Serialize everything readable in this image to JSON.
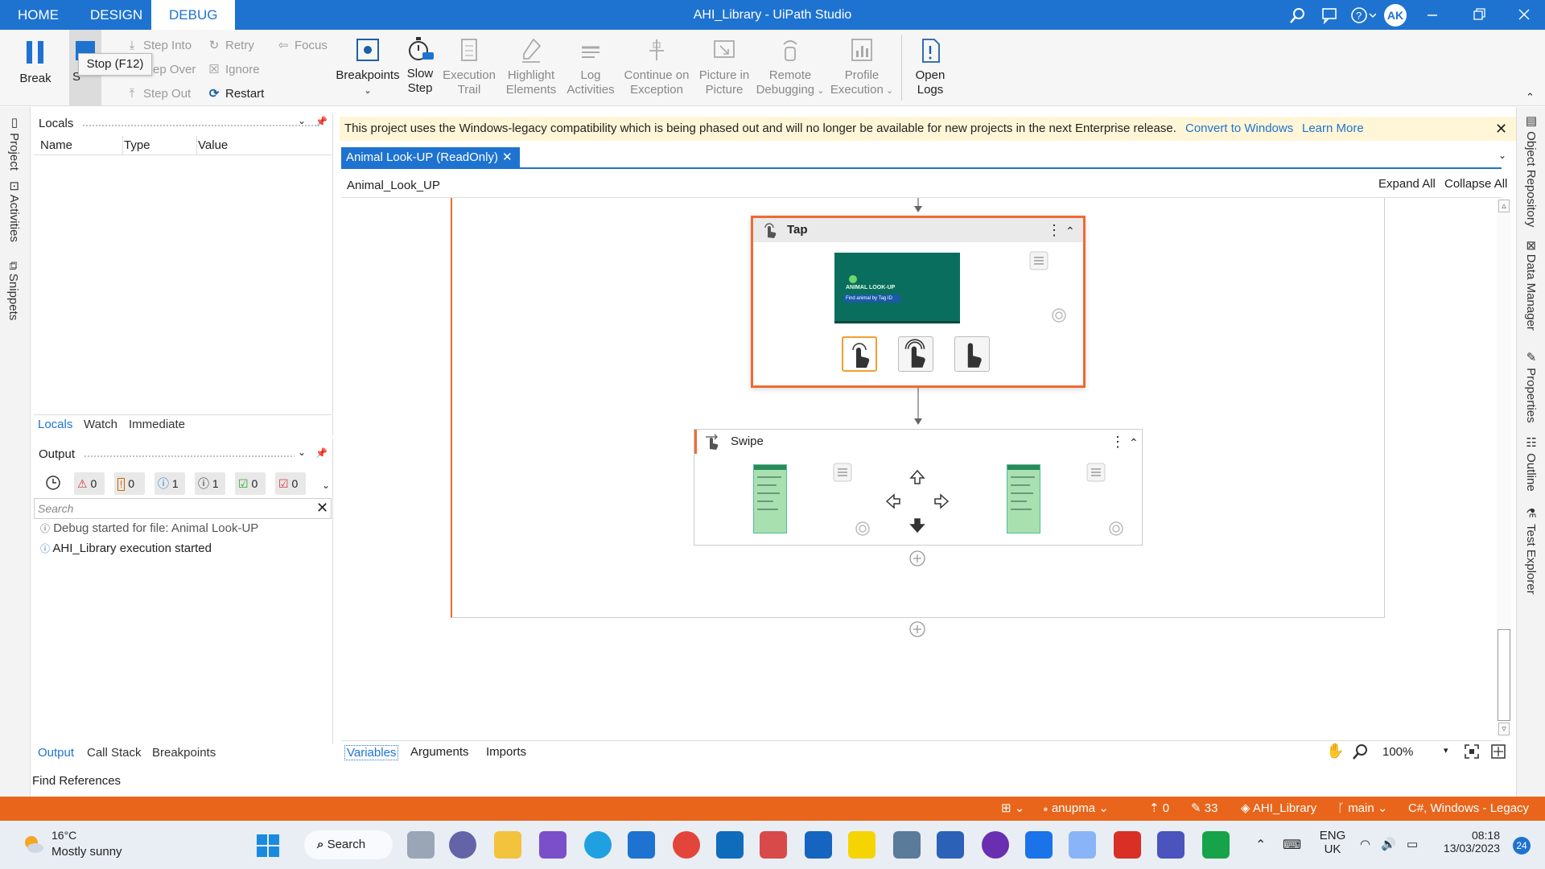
{
  "window": {
    "title": "AHI_Library - UiPath Studio",
    "user_initials": "AK",
    "menu_tabs": [
      "HOME",
      "DESIGN",
      "DEBUG"
    ],
    "active_tab": "DEBUG"
  },
  "ribbon": {
    "break": "Break",
    "stop_short": "S",
    "tooltip": "Stop (F12)",
    "step_into": "Step Into",
    "step_over": "ep Over",
    "step_out": "Step Out",
    "retry": "Retry",
    "ignore": "Ignore",
    "restart": "Restart",
    "focus": "Focus",
    "breakpoints": "Breakpoints",
    "slow_step_1": "Slow",
    "slow_step_2": "Step",
    "exec_trail_1": "Execution",
    "exec_trail_2": "Trail",
    "highlight_1": "Highlight",
    "highlight_2": "Elements",
    "log_1": "Log",
    "log_2": "Activities",
    "continue_1": "Continue on",
    "continue_2": "Exception",
    "pip_1": "Picture in",
    "pip_2": "Picture",
    "remote_1": "Remote",
    "remote_2": "Debugging",
    "profile_1": "Profile",
    "profile_2": "Execution",
    "open_logs_1": "Open",
    "open_logs_2": "Logs"
  },
  "left_strip": [
    "Project",
    "Activities",
    "Snippets"
  ],
  "right_strip": [
    "Object Repository",
    "Data Manager",
    "Properties",
    "Outline",
    "Test Explorer"
  ],
  "locals_panel": {
    "title": "Locals",
    "columns": [
      "Name",
      "Type",
      "Value"
    ],
    "tabs": [
      "Locals",
      "Watch",
      "Immediate"
    ]
  },
  "output_panel": {
    "title": "Output",
    "counts": {
      "errors": "0",
      "warnings": "0",
      "info": "1",
      "trace": "1",
      "success": "0",
      "failed": "0"
    },
    "search_placeholder": "Search",
    "messages": [
      "Debug started for file: Animal Look-UP",
      "AHI_Library execution started"
    ],
    "tabs": [
      "Output",
      "Call Stack",
      "Breakpoints"
    ]
  },
  "find_references": "Find References",
  "banner": {
    "text": "This project uses the Windows-legacy compatibility which is being phased out and will no longer be available for new projects in the next Enterprise release.",
    "convert_link": "Convert to Windows",
    "learn_link": "Learn More"
  },
  "document": {
    "tab_label": "Animal Look-UP (ReadOnly)",
    "breadcrumb": "Animal_Look_UP",
    "expand_all": "Expand All",
    "collapse_all": "Collapse All"
  },
  "activities": {
    "tap": "Tap",
    "swipe": "Swipe",
    "screenshot_text": "ANIMAL LOOK-UP",
    "screenshot_btn": "Find animal by Tag ID"
  },
  "designer_tabs": [
    "Variables",
    "Arguments",
    "Imports"
  ],
  "zoom": "100%",
  "status": {
    "user": "anupma",
    "warnings": "0",
    "edits": "33",
    "project": "AHI_Library",
    "branch": "main",
    "language": "C#, Windows - Legacy"
  },
  "taskbar": {
    "temp": "16°C",
    "weather": "Mostly sunny",
    "search": "Search",
    "lang1": "ENG",
    "lang2": "UK",
    "time": "08:18",
    "date": "13/03/2023",
    "notif": "24"
  }
}
